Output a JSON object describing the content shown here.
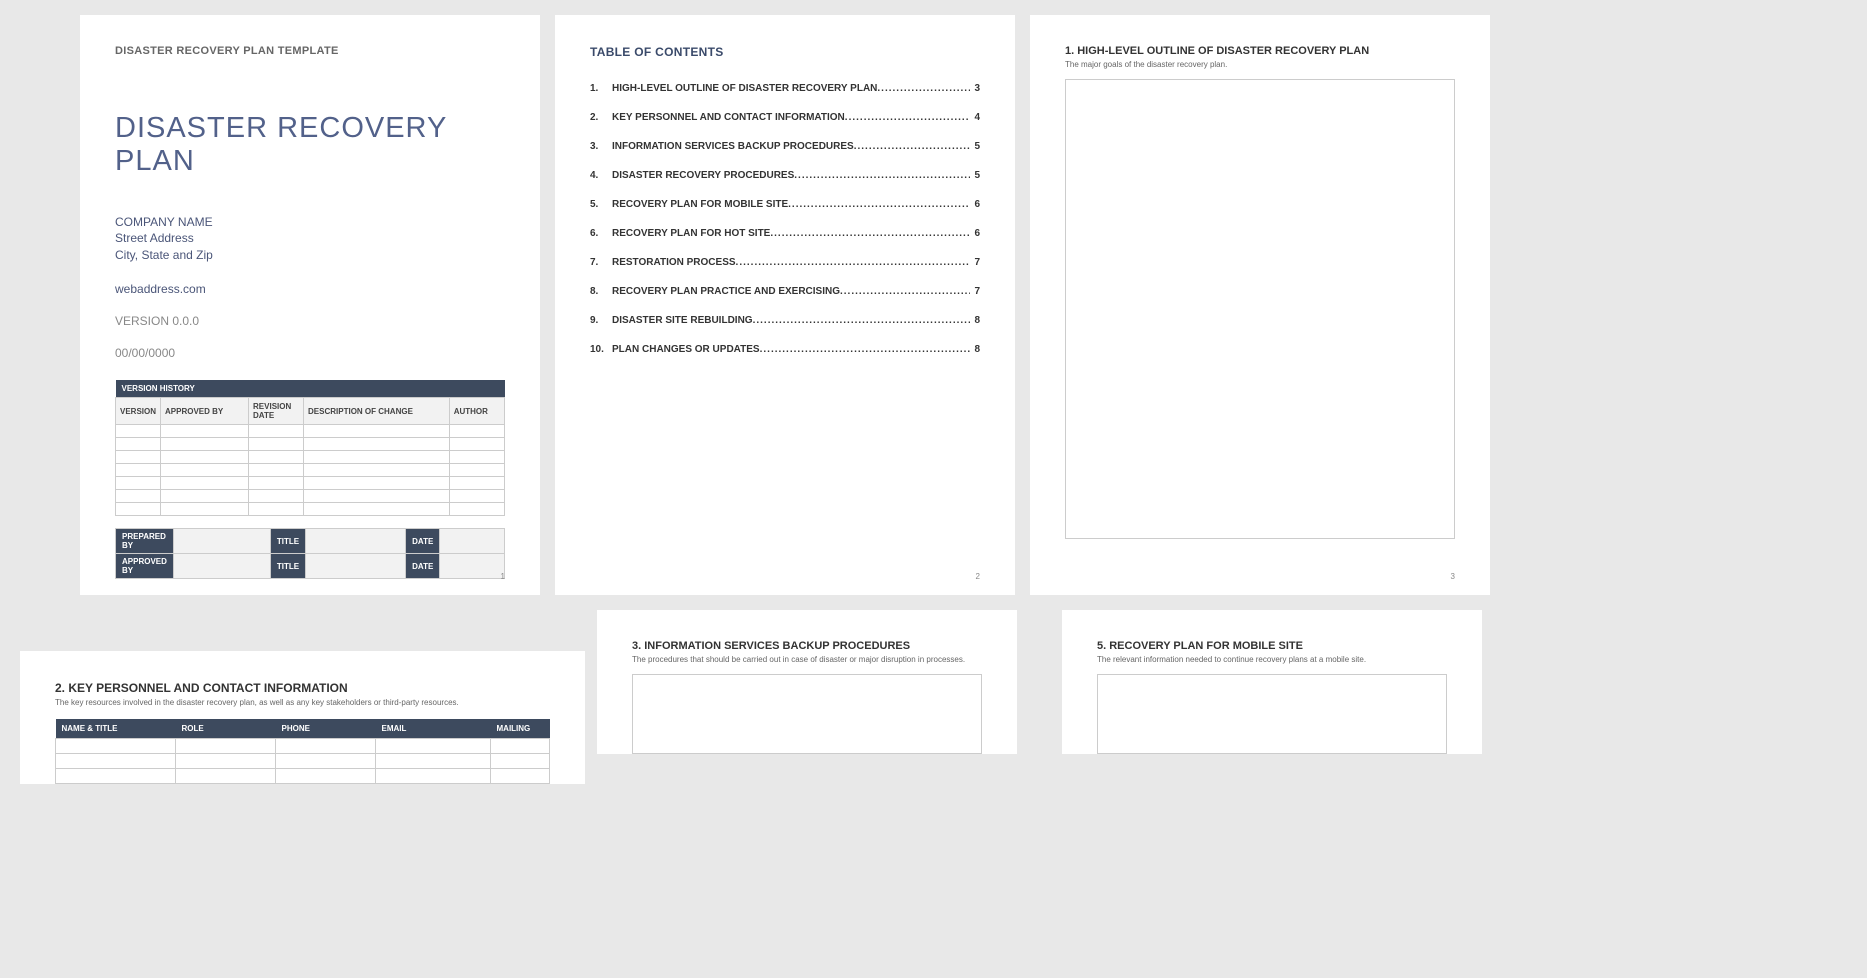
{
  "page1": {
    "template_label": "DISASTER RECOVERY PLAN TEMPLATE",
    "main_title": "DISASTER RECOVERY PLAN",
    "company": "COMPANY NAME",
    "street": "Street Address",
    "city": "City, State and Zip",
    "web": "webaddress.com",
    "version": "VERSION 0.0.0",
    "date": "00/00/0000",
    "version_history_header": "VERSION HISTORY",
    "cols": {
      "version": "VERSION",
      "approved_by": "APPROVED BY",
      "rev_date": "REVISION DATE",
      "desc": "DESCRIPTION OF CHANGE",
      "author": "AUTHOR"
    },
    "sign": {
      "prepared_by": "PREPARED BY",
      "approved_by": "APPROVED BY",
      "title": "TITLE",
      "date": "DATE"
    },
    "page_num": "1"
  },
  "page2": {
    "title": "TABLE OF CONTENTS",
    "items": [
      {
        "n": "1.",
        "t": "HIGH-LEVEL OUTLINE OF DISASTER RECOVERY PLAN",
        "p": "3"
      },
      {
        "n": "2.",
        "t": "KEY PERSONNEL AND CONTACT INFORMATION",
        "p": "4"
      },
      {
        "n": "3.",
        "t": "INFORMATION SERVICES BACKUP PROCEDURES",
        "p": "5"
      },
      {
        "n": "4.",
        "t": "DISASTER RECOVERY PROCEDURES",
        "p": "5"
      },
      {
        "n": "5.",
        "t": "RECOVERY PLAN FOR MOBILE SITE",
        "p": "6"
      },
      {
        "n": "6.",
        "t": "RECOVERY PLAN FOR HOT SITE",
        "p": "6"
      },
      {
        "n": "7.",
        "t": "RESTORATION PROCESS",
        "p": "7"
      },
      {
        "n": "8.",
        "t": "RECOVERY PLAN PRACTICE AND EXERCISING",
        "p": "7"
      },
      {
        "n": "9.",
        "t": "DISASTER SITE REBUILDING",
        "p": "8"
      },
      {
        "n": "10.",
        "t": "PLAN CHANGES OR UPDATES",
        "p": "8"
      }
    ],
    "page_num": "2"
  },
  "page3": {
    "title": "1.  HIGH-LEVEL OUTLINE OF DISASTER RECOVERY PLAN",
    "desc": "The major goals of the disaster recovery plan.",
    "page_num": "3"
  },
  "page4": {
    "title": "2.  KEY PERSONNEL AND CONTACT INFORMATION",
    "desc": "The key resources involved in the disaster recovery plan, as well as any key stakeholders or third-party resources.",
    "cols": {
      "name": "NAME & TITLE",
      "role": "ROLE",
      "phone": "PHONE",
      "email": "EMAIL",
      "mailing": "MAILING"
    }
  },
  "page5": {
    "title": "3.  INFORMATION SERVICES BACKUP PROCEDURES",
    "desc": "The procedures that should be carried out in case of disaster or major disruption in processes."
  },
  "page6": {
    "title": "5.  RECOVERY PLAN FOR MOBILE SITE",
    "desc": "The relevant information needed to continue recovery plans at a mobile site."
  }
}
